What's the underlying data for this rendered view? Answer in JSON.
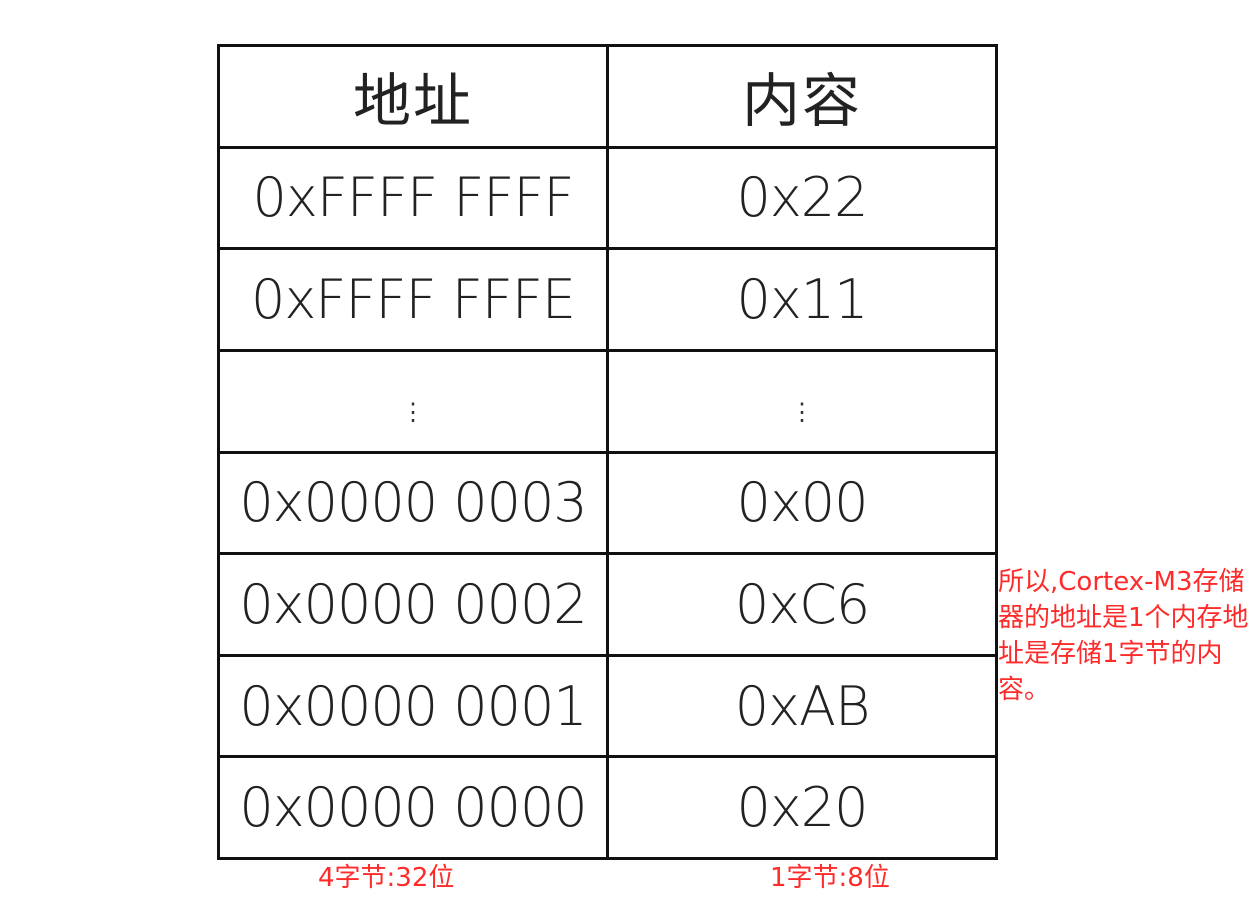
{
  "table": {
    "headers": {
      "address": "地址",
      "content": "内容"
    },
    "rows": [
      {
        "address": "0xFFFF FFFF",
        "content": "0x22"
      },
      {
        "address": "0xFFFF FFFE",
        "content": "0x11"
      },
      {
        "address": "⋮",
        "content": "⋮"
      },
      {
        "address": "0x0000 0003",
        "content": "0x00"
      },
      {
        "address": "0x0000 0002",
        "content": "0xC6"
      },
      {
        "address": "0x0000 0001",
        "content": "0xAB"
      },
      {
        "address": "0x0000 0000",
        "content": "0x20"
      }
    ]
  },
  "captions": {
    "address_width": "4字节:32位",
    "content_width": "1字节:8位"
  },
  "note": "所以,Cortex-M3存储器的地址是1个内存地址是存储1字节的内容。",
  "colors": {
    "annotation": "#ff2a2a",
    "border": "#111111",
    "text": "#222222"
  }
}
